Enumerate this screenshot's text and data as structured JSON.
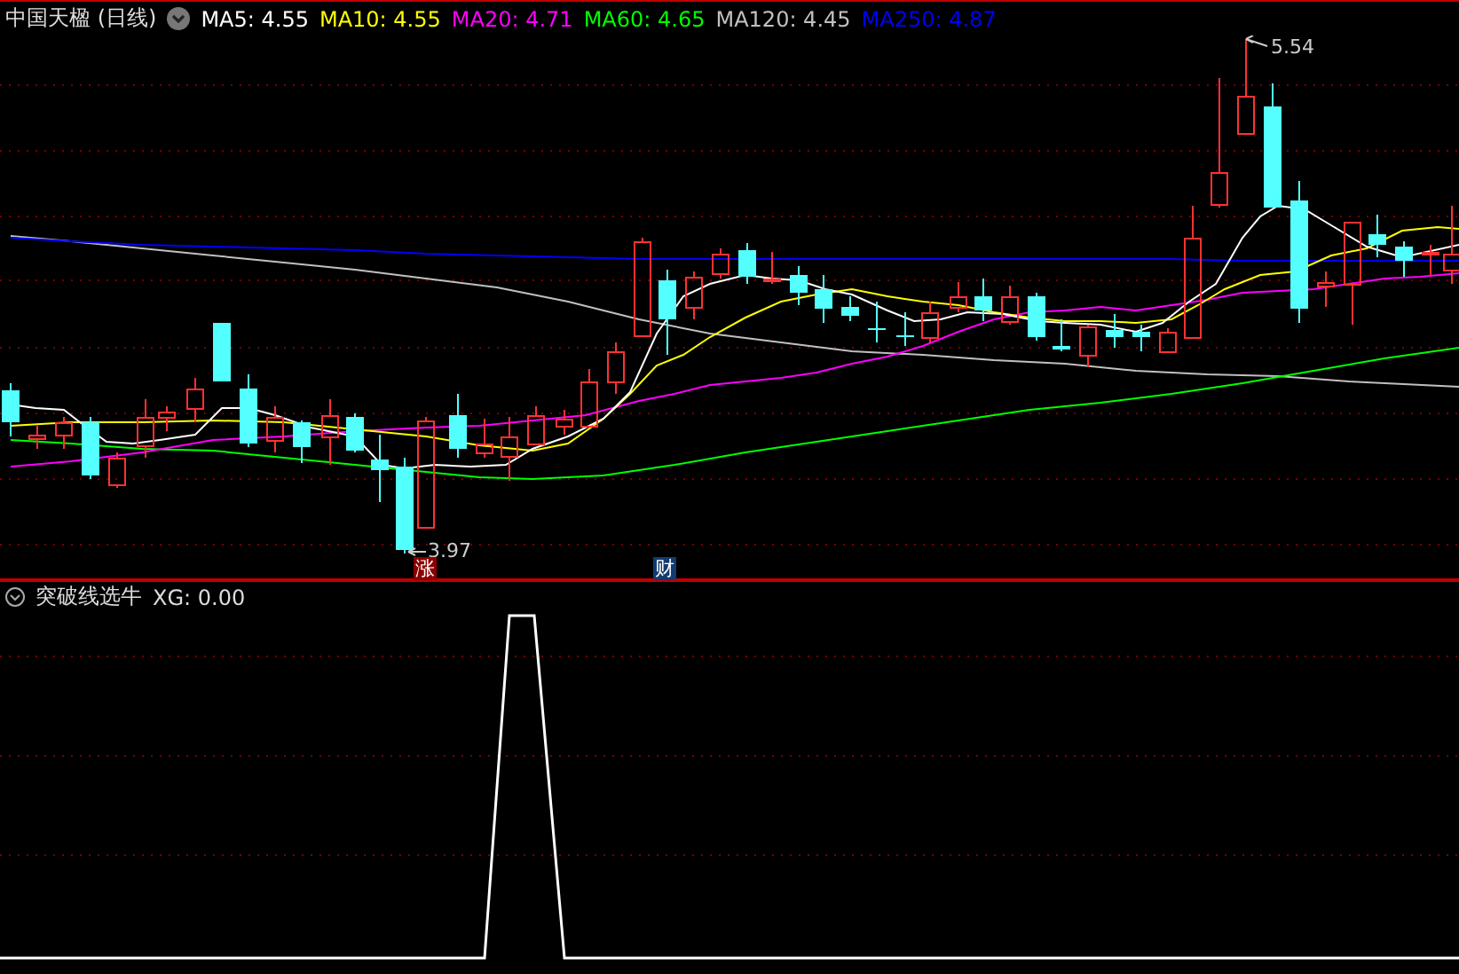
{
  "header": {
    "title": "中国天楹 (日线)",
    "indicators": [
      {
        "text": "MA5: 4.55",
        "color": "#ffffff"
      },
      {
        "text": "MA10: 4.55",
        "color": "#ffff00"
      },
      {
        "text": "MA20: 4.71",
        "color": "#ff00ff"
      },
      {
        "text": "MA60: 4.65",
        "color": "#00ff00"
      },
      {
        "text": "MA120: 4.45",
        "color": "#c0c0c0"
      },
      {
        "text": "MA250: 4.87",
        "color": "#0000ff"
      }
    ]
  },
  "price_chart": {
    "high_label": "5.54",
    "low_label": "3.97",
    "badges": [
      {
        "text": "涨",
        "kind": "rise"
      },
      {
        "text": "财",
        "kind": "finance"
      }
    ]
  },
  "indicator_pane": {
    "title": "突破线选牛",
    "reading": "XG: 0.00"
  }
}
